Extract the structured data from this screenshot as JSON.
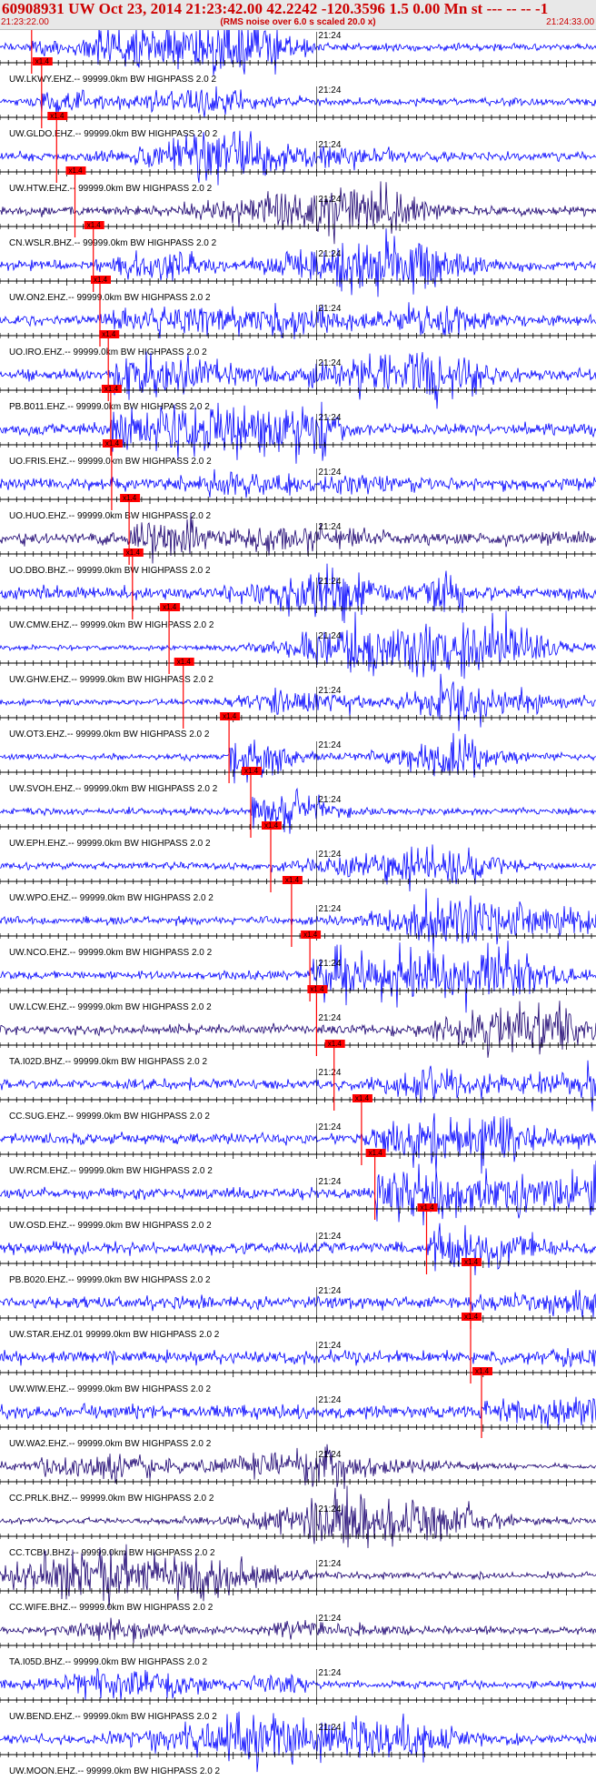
{
  "header": {
    "title": "60908931 UW Oct 23, 2014 21:23:42.00   42.2242 -120.3596  1.5 0.00 Mn st --- -- --  -1",
    "start_time": "21:23:22.00",
    "subtitle": "(RMS noise over 6.0 s scaled 20.0 x)",
    "end_time": "21:24:33.00"
  },
  "colors": {
    "trace_blue": "#0000ff",
    "trace_navy": "#1a0070",
    "pick_red": "#ff0000",
    "text_red": "#cc0000",
    "header_bg": "#e8e8e8"
  },
  "chart_data": {
    "type": "line",
    "title": "60908931 UW Oct 23, 2014 21:23:42.00   42.2242 -120.3596  1.5 0.00 Mn st --- -- --  -1",
    "subtitle": "(RMS noise over 6.0 s scaled 20.0 x)",
    "x_range": [
      "21:23:22.00",
      "21:24:33.00"
    ],
    "x_tick_label": "21:24",
    "pick_label": "x1.4",
    "grid": false,
    "series": [
      {
        "name": "UW.LKWY.EHZ.-- 99999.0km BW  HIGHPASS  2.0  2",
        "pick_time": "21:23:25.8",
        "color": "blue"
      },
      {
        "name": "UW.GLDO.EHZ.-- 99999.0km BW  HIGHPASS  2.0  2",
        "pick_time": "21:23:27.0",
        "color": "blue"
      },
      {
        "name": "UW.HTW.EHZ.-- 99999.0km BW  HIGHPASS  2.0  2",
        "pick_time": "21:23:28.8",
        "color": "blue"
      },
      {
        "name": "CN.WSLR.BHZ.-- 99999.0km BW  HIGHPASS  2.0  2",
        "pick_time": "21:23:31.0",
        "color": "navy"
      },
      {
        "name": "UW.ON2.EHZ.-- 99999.0km BW  HIGHPASS  2.0  2",
        "pick_time": "21:23:33.2",
        "color": "blue"
      },
      {
        "name": "UO.IRO.EHZ.-- 99999.0km BW  HIGHPASS  2.0  2",
        "pick_time": "21:23:34.0",
        "color": "blue"
      },
      {
        "name": "PB.B011.EHZ.-- 99999.0km BW  HIGHPASS  2.0  2",
        "pick_time": "21:23:35.0",
        "color": "blue"
      },
      {
        "name": "UO.FRIS.EHZ.-- 99999.0km BW  HIGHPASS  2.0  2",
        "pick_time": "21:23:35.3",
        "color": "blue"
      },
      {
        "name": "UO.HUO.EHZ.-- 99999.0km BW  HIGHPASS  2.0  2",
        "pick_time": "21:23:35.4",
        "color": "blue"
      },
      {
        "name": "UO.DBO.BHZ.-- 99999.0km BW  HIGHPASS  2.0  2",
        "pick_time": "21:23:37.5",
        "color": "navy"
      },
      {
        "name": "UW.CMW.EHZ.-- 99999.0km BW  HIGHPASS  2.0  2",
        "pick_time": "21:23:37.9",
        "color": "blue"
      },
      {
        "name": "UW.GHW.EHZ.-- 99999.0km BW  HIGHPASS  2.0  2",
        "pick_time": "21:23:42.3",
        "color": "blue"
      },
      {
        "name": "UW.OT3.EHZ.-- 99999.0km BW  HIGHPASS  2.0  2",
        "pick_time": "21:23:44.0",
        "color": "blue"
      },
      {
        "name": "UW.SVOH.EHZ.-- 99999.0km BW  HIGHPASS  2.0  2",
        "pick_time": "21:23:49.5",
        "color": "blue"
      },
      {
        "name": "UW.EPH.EHZ.-- 99999.0km BW  HIGHPASS  2.0  2",
        "pick_time": "21:23:52.1",
        "color": "blue"
      },
      {
        "name": "UW.WPO.EHZ.-- 99999.0km BW  HIGHPASS  2.0  2",
        "pick_time": "21:23:54.5",
        "color": "blue"
      },
      {
        "name": "UW.NCO.EHZ.-- 99999.0km BW  HIGHPASS  2.0  2",
        "pick_time": "21:23:57.0",
        "color": "blue"
      },
      {
        "name": "UW.LCW.EHZ.-- 99999.0km BW  HIGHPASS  2.0  2",
        "pick_time": "21:23:59.2",
        "color": "blue"
      },
      {
        "name": "TA.I02D.BHZ.-- 99999.0km BW  HIGHPASS  2.0  2",
        "pick_time": "21:24:00.0",
        "color": "navy"
      },
      {
        "name": "CC.SUG.EHZ.-- 99999.0km BW  HIGHPASS  2.0  2",
        "pick_time": "21:24:02.1",
        "color": "blue"
      },
      {
        "name": "UW.RCM.EHZ.-- 99999.0km BW  HIGHPASS  2.0  2",
        "pick_time": "21:24:05.4",
        "color": "blue"
      },
      {
        "name": "UW.OSD.EHZ.-- 99999.0km BW  HIGHPASS  2.0  2",
        "pick_time": "21:24:07.0",
        "color": "blue"
      },
      {
        "name": "PB.B020.EHZ.-- 99999.0km BW  HIGHPASS  2.0  2",
        "pick_time": "21:24:13.2",
        "color": "blue"
      },
      {
        "name": "UW.STAR.EHZ.01 99999.0km BW  HIGHPASS  2.0  2",
        "pick_time": "21:24:18.5",
        "color": "blue"
      },
      {
        "name": "UW.WIW.EHZ.-- 99999.0km BW  HIGHPASS  2.0  2",
        "pick_time": "21:24:18.5",
        "color": "blue"
      },
      {
        "name": "UW.WA2.EHZ.-- 99999.0km BW  HIGHPASS  2.0  2",
        "pick_time": "21:24:19.8",
        "color": "blue"
      },
      {
        "name": "CC.PRLK.BHZ.-- 99999.0km BW  HIGHPASS  2.0  2",
        "pick_time": null,
        "color": "navy"
      },
      {
        "name": "CC.TCBU.BHZ.-- 99999.0km BW  HIGHPASS  2.0  2",
        "pick_time": null,
        "color": "navy"
      },
      {
        "name": "CC.WIFE.BHZ.-- 99999.0km BW  HIGHPASS  2.0  2",
        "pick_time": null,
        "color": "navy"
      },
      {
        "name": "TA.I05D.BHZ.-- 99999.0km BW  HIGHPASS  2.0  2",
        "pick_time": null,
        "color": "navy"
      },
      {
        "name": "UW.BEND.EHZ.-- 99999.0km BW  HIGHPASS  2.0  2",
        "pick_time": null,
        "color": "blue"
      },
      {
        "name": "UW.MOON.EHZ.-- 99999.0km BW  HIGHPASS  2.0  2",
        "pick_time": null,
        "color": "blue"
      }
    ]
  }
}
